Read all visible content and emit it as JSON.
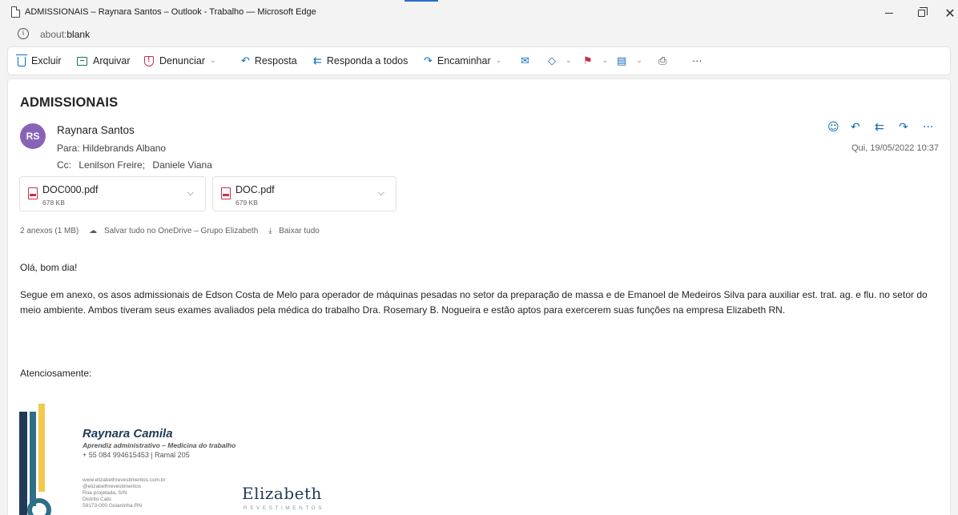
{
  "window": {
    "title": "ADMISSIONAIS – Raynara Santos – Outlook - Trabalho — Microsoft Edge",
    "url_prefix": "about:",
    "url_rest": "blank"
  },
  "toolbar": {
    "excluir": "Excluir",
    "arquivar": "Arquivar",
    "denunciar": "Denunciar",
    "resposta": "Resposta",
    "responda_todos": "Responda a todos",
    "encaminhar": "Encaminhar",
    "more": "···"
  },
  "message": {
    "subject": "ADMISSIONAIS",
    "avatar_initials": "RS",
    "avatar_color": "#8764b8",
    "sender": "Raynara Santos",
    "to": "Para: Hildebrands Albano",
    "cc_label": "Cc:",
    "cc": [
      "Lenilson Freire;",
      "Daniele Viana"
    ],
    "date": "Qui, 19/05/2022 10:37"
  },
  "attachments": [
    {
      "name": "DOC000.pdf",
      "size": "678 KB"
    },
    {
      "name": "DOC.pdf",
      "size": "679 KB"
    }
  ],
  "attachment_info": {
    "count": "2 anexos (1 MB)",
    "save_onedrive": "Salvar tudo no OneDrive – Grupo Elizabeth",
    "download_all": "Baixar tudo"
  },
  "body": {
    "greeting": "Olá, bom dia!",
    "paragraph": "Segue em anexo, os asos admissionais de Edson Costa de Melo para operador de máquinas pesadas no setor da preparação de massa e de Emanoel de Medeiros Silva para auxiliar est. trat. ag. e flu. no setor do meio ambiente. Ambos tiveram seus exames avaliados pela médica do trabalho Dra. Rosemary B. Nogueira e estão aptos para exercerem suas funções na empresa Elizabeth RN.",
    "closing": "Atenciosamente:"
  },
  "signature": {
    "name": "Raynara Camila",
    "role": "Aprendiz administrativo – Medicina do trabalho",
    "phone": "+ 55 084 994615453 | Ramal 205",
    "website": "www.elizabethrevestimentos.com.br",
    "instagram": "@elizabethrevestimentos",
    "address1": "Rua projetada, S/N",
    "address2": "Distrito Catú",
    "address3": "59173-000 Goianinha-RN",
    "logo": "Elizabeth",
    "logo_sub": "REVESTIMENTOS"
  },
  "colors": {
    "accent": "#0f6cbd",
    "danger": "#c4314b",
    "archive": "#107c41",
    "brand_dark": "#1f3b57",
    "brand_yellow": "#f2c94c"
  }
}
